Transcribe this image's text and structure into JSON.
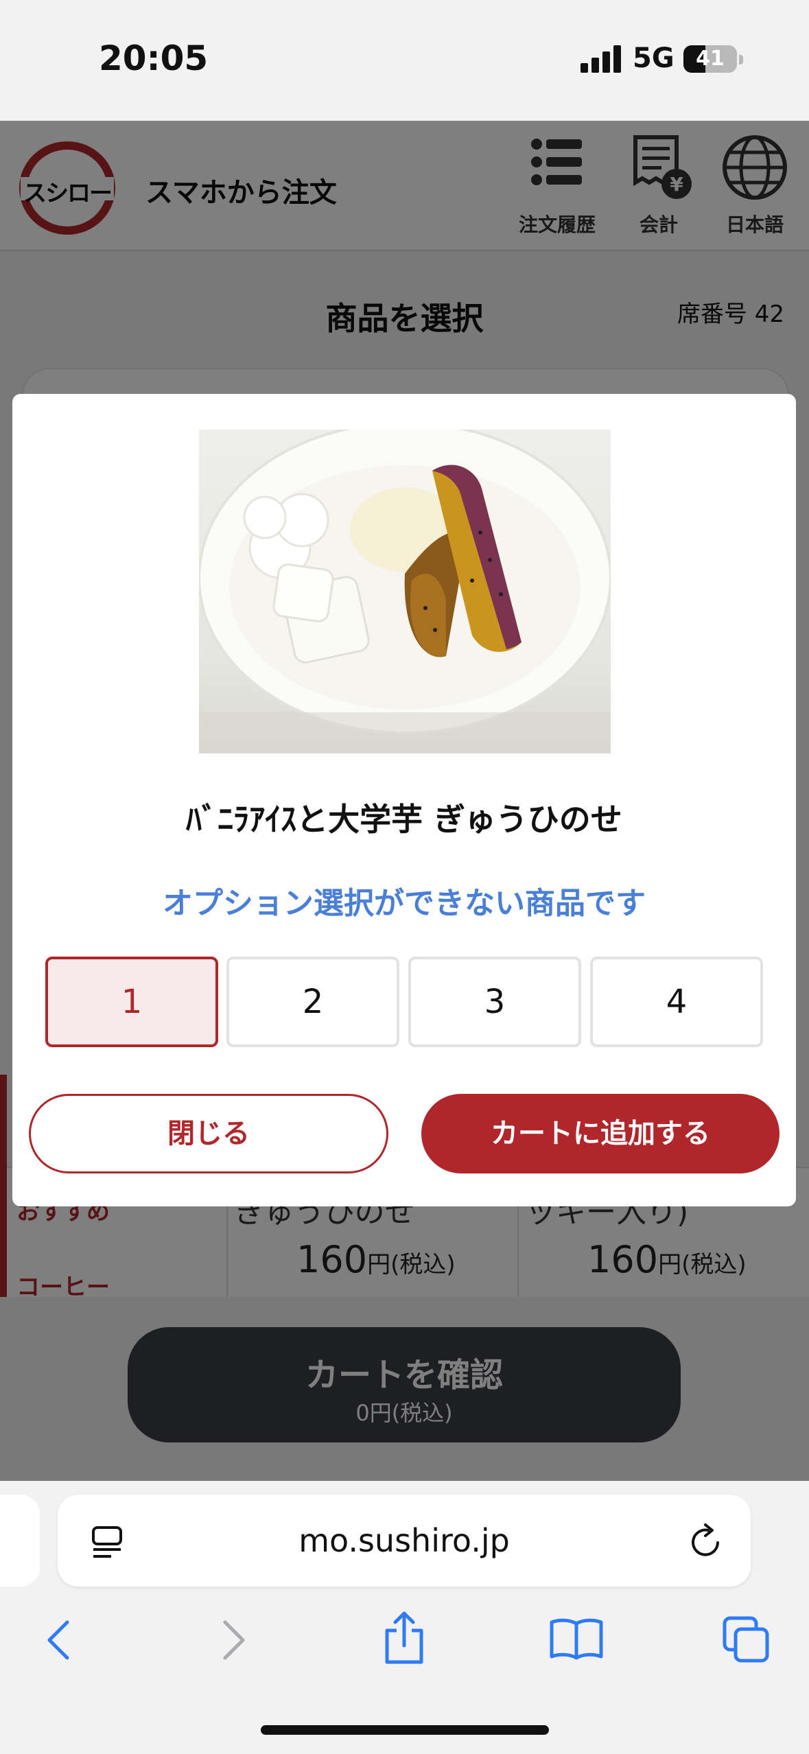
{
  "status_bar": {
    "time": "20:05",
    "network": "5G",
    "battery": "41",
    "battery_level": 0.41
  },
  "header": {
    "logo_text": "スシロー",
    "title": "スマホから注文",
    "buttons": [
      {
        "label": "注文履歴",
        "icon": "list-icon"
      },
      {
        "label": "会計",
        "icon": "receipt-yen-icon"
      },
      {
        "label": "日本語",
        "icon": "globe-icon"
      }
    ]
  },
  "page": {
    "title": "商品を選択",
    "seat": "席番号 42"
  },
  "menu_bg": {
    "category_1": "おすすめ",
    "category_2": "コーヒー",
    "items": [
      {
        "name": "ぎゅうひのせ",
        "price": "160",
        "price_unit": "円",
        "tax": "(税込)"
      },
      {
        "name": "ッキー入り)",
        "price": "160",
        "price_unit": "円",
        "tax": "(税込)"
      }
    ]
  },
  "cart": {
    "label": "カートを確認",
    "total": "0円(税込)"
  },
  "modal": {
    "item_name": "ﾊﾞﾆﾗｱｲｽと大学芋 ぎゅうひのせ",
    "note": "オプション選択ができない商品です",
    "quantities": [
      "1",
      "2",
      "3",
      "4"
    ],
    "selected_quantity": "1",
    "close_label": "閉じる",
    "add_label": "カートに追加する"
  },
  "browser": {
    "url": "mo.sushiro.jp"
  },
  "colors": {
    "brand_red": "#b0262b",
    "note_blue": "#4a7fd8",
    "cart_dark": "#3b3f47"
  }
}
